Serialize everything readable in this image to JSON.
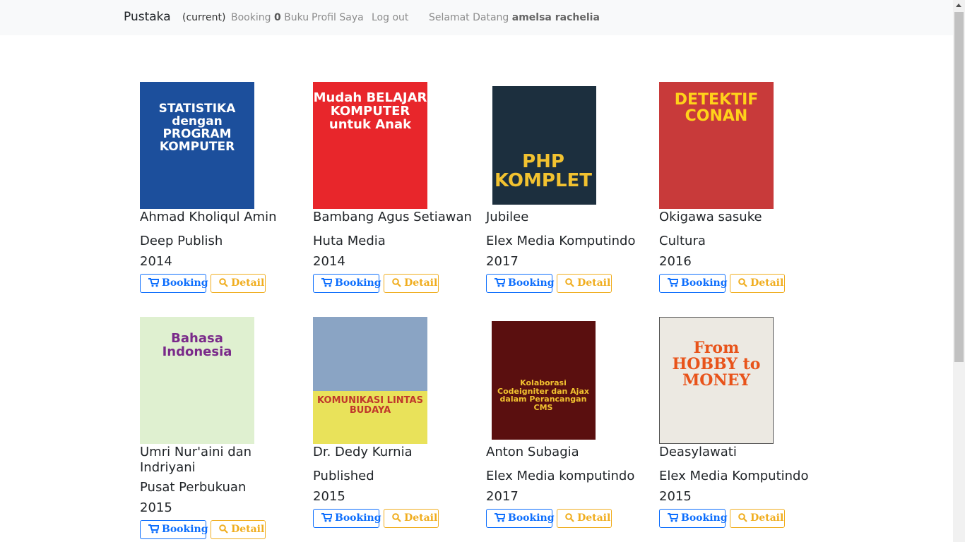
{
  "navbar": {
    "brand": "Pustaka",
    "current": "(current)",
    "booking_prefix": "Booking",
    "booking_count": "0",
    "booking_suffix": "Buku",
    "profil": "Profil Saya",
    "logout": "Log out",
    "welcome_prefix": "Selamat Datang",
    "username": "amelsa rachelia"
  },
  "buttons": {
    "booking": "Booking",
    "detail": "Detail"
  },
  "books": [
    {
      "author": "Ahmad Kholiqul Amin",
      "publisher": "Deep Publish",
      "year": "2014",
      "cover_text": "STATISTIKA dengan PROGRAM KOMPUTER",
      "cover_bg": "#1c4f9c"
    },
    {
      "author": "Bambang Agus Setiawan",
      "publisher": "Huta Media",
      "year": "2014",
      "cover_text": "Mudah BELAJAR KOMPUTER untuk Anak",
      "cover_bg": "#e8262b"
    },
    {
      "author": "Jubilee",
      "publisher": "Elex Media Komputindo",
      "year": "2017",
      "cover_text": "PHP KOMPLET",
      "cover_bg": "#1c2f3e"
    },
    {
      "author": "Okigawa sasuke",
      "publisher": "Cultura",
      "year": "2016",
      "cover_text": "DETEKTIF CONAN",
      "cover_bg": "#c83a3a"
    },
    {
      "author": "Umri Nur'aini dan Indriyani",
      "publisher": "Pusat Perbukuan",
      "year": "2015",
      "cover_text": "Bahasa Indonesia",
      "cover_bg": "#dff0d0"
    },
    {
      "author": "Dr. Dedy Kurnia",
      "publisher": "Published",
      "year": "2015",
      "cover_text": "KOMUNIKASI LINTAS BUDAYA",
      "cover_bg": "#e9e25a"
    },
    {
      "author": "Anton Subagia",
      "publisher": "Elex Media komputindo",
      "year": "2017",
      "cover_text": "Kolaborasi Codeigniter dan Ajax dalam Perancangan CMS",
      "cover_bg": "#5a0f0f"
    },
    {
      "author": "Deasylawati",
      "publisher": "Elex Media Komputindo",
      "year": "2015",
      "cover_text": "From HOBBY to MONEY",
      "cover_bg": "#ece9e2"
    }
  ]
}
